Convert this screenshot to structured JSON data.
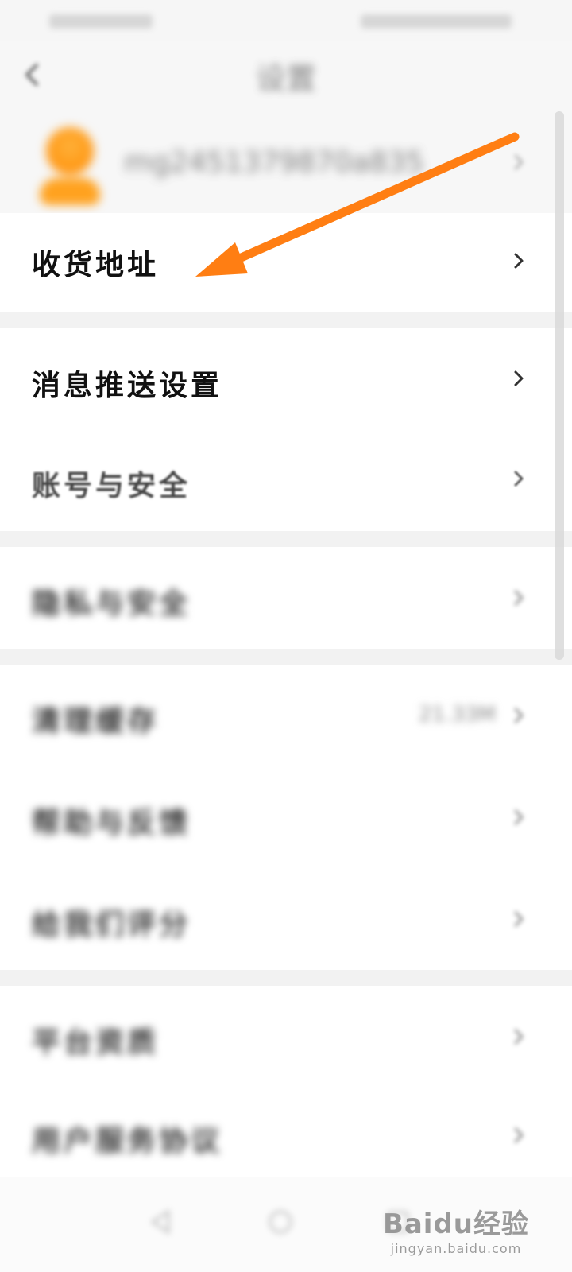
{
  "status_bar": {
    "left_text": "",
    "right_text": ""
  },
  "header": {
    "title": "设置"
  },
  "profile": {
    "name": "mg2451379870a835"
  },
  "rows": [
    {
      "label": "收货地址"
    },
    {
      "label": "消息推送设置"
    },
    {
      "label": "账号与安全"
    },
    {
      "label": "隐私与安全"
    },
    {
      "label": "清理缓存",
      "value": "21.33M"
    },
    {
      "label": "帮助与反馈"
    },
    {
      "label": "给我们评分"
    },
    {
      "label": "平台资质"
    },
    {
      "label": "用户服务协议"
    }
  ],
  "annotation": {
    "arrow_color": "#ff7e13"
  },
  "watermark": {
    "logo": "Baidu经验",
    "sub": "jingyan.baidu.com"
  },
  "icons": {
    "back": "back-arrow-icon",
    "row_chevron": "chevron-right-icon"
  }
}
